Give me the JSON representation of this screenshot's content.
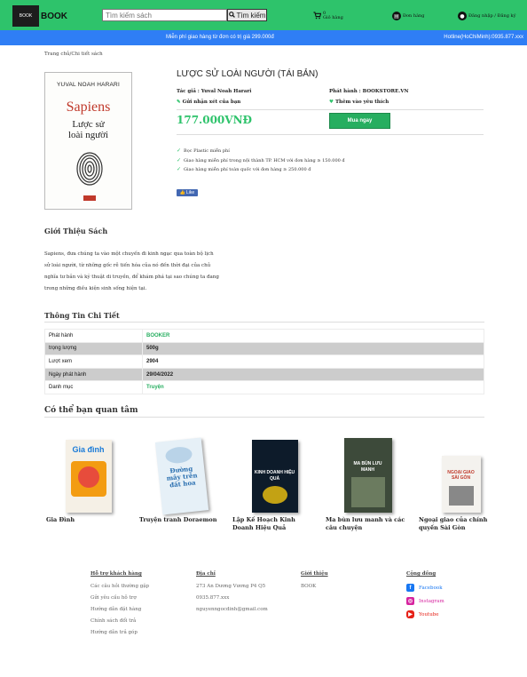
{
  "header": {
    "logo_small": "BOOK",
    "logo_text": "BOOK",
    "search_placeholder": "Tìm kiếm sách",
    "search_button": "Tìm kiếm",
    "cart_count": "0",
    "cart_label": "Giỏ hàng",
    "orders_label": "Đơn hàng",
    "account_label": "Đăng nhập / Đăng ký"
  },
  "promo_bar": {
    "text": "Miễn phí giao hàng từ đơn có trị giá 299.000đ",
    "hotline": "Hotline(HoChiMinh):0935.877.xxx"
  },
  "breadcrumb": "Trang chủ/Chi tiết sách",
  "book": {
    "cover_author": "YUVAL NOAH HARARI",
    "cover_title": "Sapiens",
    "cover_subtitle_1": "Lược sử",
    "cover_subtitle_2": "loài người",
    "title": "LƯỢC SỬ LOÀI NGƯỜI (TÁI BẢN)",
    "author": "Tác giả : Yuval Noah Harari",
    "publisher": "Phát hành : BOOKSTORE.VN",
    "review_label": "Gửi nhận xét của bạn",
    "wishlist_label": "Thêm vào yêu thích",
    "price": "177.000VNĐ",
    "buy_label": "Mua ngay",
    "benefits": [
      "Bọc Plastic miễn phí",
      "Giao hàng miễn phí trong nội thành TP. HCM với đơn hàng ≥ 150.000 đ",
      "Giao hàng miễn phí toàn quốc với đơn hàng ≥ 250.000 đ"
    ],
    "like_label": "Like"
  },
  "intro": {
    "heading": "Giới Thiệu Sách",
    "lines": [
      "Sapiens, đưa chúng ta vào một chuyến đi kinh ngạc qua toàn bộ lịch",
      "sử loài người, từ những gốc rễ tiến hóa của nó đến thời đại của chủ",
      "nghĩa tư bản và kỹ thuật di truyền, để khám phá tại sao chúng ta đang",
      "trong những điều kiện sinh sống hiện tại."
    ]
  },
  "details": {
    "heading": "Thông Tin Chi Tiết",
    "rows": [
      {
        "key": "Phát hành",
        "value": "BOOKER"
      },
      {
        "key": "trọng lượng",
        "value": "500g"
      },
      {
        "key": "Lượt xem",
        "value": "2904"
      },
      {
        "key": "Ngày phát hành",
        "value": "29/04/2022"
      },
      {
        "key": "Danh mục",
        "value": "Truyện"
      }
    ]
  },
  "recommend": {
    "heading": "Có thể bạn quan tâm",
    "items": [
      {
        "name": "Gia Đình",
        "cover_text": "Gia đình"
      },
      {
        "name": "Truyện tranh Doraemon",
        "cover_text": "Đường mây trên đất hoa"
      },
      {
        "name": "Lập Kế Hoạch Kinh Doanh Hiệu Quả",
        "cover_text": "KINH DOANH HIỆU QUẢ"
      },
      {
        "name": "Ma bùn lưu manh và các câu chuyện",
        "cover_text": "MA BÙN LƯU MANH"
      },
      {
        "name": "Ngoại giao của chính quyền Sài Gòn",
        "cover_text": "NGOẠI GIAO SÀI GÒN"
      }
    ]
  },
  "footer": {
    "support": {
      "heading": "Hỗ trợ khách hàng",
      "items": [
        "Các câu hỏi thường gặp",
        "Gửi yêu cầu hỗ trợ",
        "Hướng dẫn đặt hàng",
        "Chính sách đổi trả",
        "Hướng dẫn trả góp"
      ]
    },
    "address": {
      "heading": "Địa chỉ",
      "items": [
        "273 An Dương Vương P4 Q5",
        "0935.877.xxx",
        "nguyenngocdinh@gmail.com"
      ]
    },
    "about": {
      "heading": "Giới thiệu",
      "items": [
        "BOOK"
      ]
    },
    "community": {
      "heading": "Cộng đồng",
      "items": [
        "Facebook",
        "Instagram",
        "Youtube"
      ]
    }
  },
  "colors": {
    "brand_green": "#2ec36b",
    "promo_blue": "#2f7ef5",
    "price_green": "#2ec36b"
  }
}
